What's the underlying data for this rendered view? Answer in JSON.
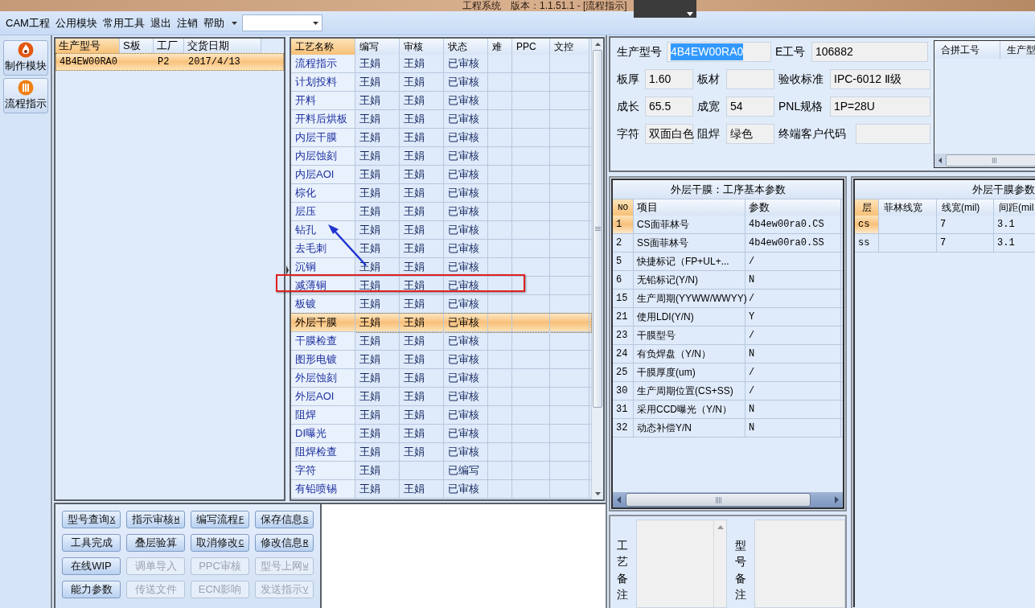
{
  "window": {
    "title": "工程系统　版本：1.1.51.1 - [流程指示]"
  },
  "menu": [
    "CAM工程",
    "公用模块",
    "常用工具",
    "退出",
    "注销",
    "帮助"
  ],
  "nav": [
    {
      "label": "制作模块",
      "kind": "flame"
    },
    {
      "label": "流程指示",
      "kind": "pause"
    }
  ],
  "orders": {
    "columns": [
      "生产型号",
      "S板",
      "工厂",
      "交货日期"
    ],
    "rows": [
      {
        "cells": [
          "4B4EW00RA0",
          "",
          "P2",
          "2017/4/13"
        ],
        "selected": true
      }
    ]
  },
  "process": {
    "columns": [
      "工艺名称",
      "编写",
      "审核",
      "状态",
      "难",
      "PPC",
      "文控"
    ],
    "rows": [
      {
        "name": "流程指示",
        "writer": "王娟",
        "reviewer": "王娟",
        "status": "已审核",
        "selected": false,
        "highlighted": false
      },
      {
        "name": "计划投料",
        "writer": "王娟",
        "reviewer": "王娟",
        "status": "已审核",
        "selected": false,
        "highlighted": false
      },
      {
        "name": "开料",
        "writer": "王娟",
        "reviewer": "王娟",
        "status": "已审核",
        "selected": false,
        "highlighted": false
      },
      {
        "name": "开料后烘板",
        "writer": "王娟",
        "reviewer": "王娟",
        "status": "已审核",
        "selected": false,
        "highlighted": false
      },
      {
        "name": "内层干膜",
        "writer": "王娟",
        "reviewer": "王娟",
        "status": "已审核",
        "selected": false,
        "highlighted": false
      },
      {
        "name": "内层蚀刻",
        "writer": "王娟",
        "reviewer": "王娟",
        "status": "已审核",
        "selected": false,
        "highlighted": false
      },
      {
        "name": "内层AOI",
        "writer": "王娟",
        "reviewer": "王娟",
        "status": "已审核",
        "selected": false,
        "highlighted": false
      },
      {
        "name": "棕化",
        "writer": "王娟",
        "reviewer": "王娟",
        "status": "已审核",
        "selected": false,
        "highlighted": false
      },
      {
        "name": "层压",
        "writer": "王娟",
        "reviewer": "王娟",
        "status": "已审核",
        "selected": false,
        "highlighted": false
      },
      {
        "name": "钻孔",
        "writer": "王娟",
        "reviewer": "王娟",
        "status": "已审核",
        "selected": false,
        "highlighted": false
      },
      {
        "name": "去毛刺",
        "writer": "王娟",
        "reviewer": "王娟",
        "status": "已审核",
        "selected": false,
        "highlighted": false
      },
      {
        "name": "沉铜",
        "writer": "王娟",
        "reviewer": "王娟",
        "status": "已审核",
        "selected": false,
        "highlighted": false
      },
      {
        "name": "减薄铜",
        "writer": "王娟",
        "reviewer": "王娟",
        "status": "已审核",
        "selected": false,
        "highlighted": true
      },
      {
        "name": "板镀",
        "writer": "王娟",
        "reviewer": "王娟",
        "status": "已审核",
        "selected": false,
        "highlighted": false
      },
      {
        "name": "外层干膜",
        "writer": "王娟",
        "reviewer": "王娟",
        "status": "已审核",
        "selected": true,
        "highlighted": false
      },
      {
        "name": "干膜检查",
        "writer": "王娟",
        "reviewer": "王娟",
        "status": "已审核",
        "selected": false,
        "highlighted": false
      },
      {
        "name": "图形电镀",
        "writer": "王娟",
        "reviewer": "王娟",
        "status": "已审核",
        "selected": false,
        "highlighted": false
      },
      {
        "name": "外层蚀刻",
        "writer": "王娟",
        "reviewer": "王娟",
        "status": "已审核",
        "selected": false,
        "highlighted": false
      },
      {
        "name": "外层AOI",
        "writer": "王娟",
        "reviewer": "王娟",
        "status": "已审核",
        "selected": false,
        "highlighted": false
      },
      {
        "name": "阻焊",
        "writer": "王娟",
        "reviewer": "王娟",
        "status": "已审核",
        "selected": false,
        "highlighted": false
      },
      {
        "name": "DI曝光",
        "writer": "王娟",
        "reviewer": "王娟",
        "status": "已审核",
        "selected": false,
        "highlighted": false
      },
      {
        "name": "阻焊检查",
        "writer": "王娟",
        "reviewer": "王娟",
        "status": "已审核",
        "selected": false,
        "highlighted": false
      },
      {
        "name": "字符",
        "writer": "王娟",
        "status": "已编写",
        "selected": false,
        "highlighted": false
      },
      {
        "name": "有铅喷锡",
        "writer": "王娟",
        "reviewer": "王娟",
        "status": "已审核",
        "selected": false,
        "highlighted": false
      }
    ]
  },
  "actions": [
    {
      "label": "型号查询",
      "hotkey": "X",
      "disabled": false
    },
    {
      "label": "指示审核",
      "hotkey": "H",
      "disabled": false
    },
    {
      "label": "编写流程",
      "hotkey": "F",
      "disabled": false
    },
    {
      "label": "保存信息",
      "hotkey": "S",
      "disabled": false
    },
    {
      "label": "工具完成",
      "disabled": false
    },
    {
      "label": "叠层验算",
      "disabled": false
    },
    {
      "label": "取消修改",
      "hotkey": "C",
      "disabled": false
    },
    {
      "label": "修改信息",
      "hotkey": "R",
      "disabled": false
    },
    {
      "label": "在线WIP",
      "disabled": false
    },
    {
      "label": "调单导入",
      "disabled": true
    },
    {
      "label": "PPC审核",
      "disabled": true
    },
    {
      "label": "型号上网",
      "hotkey": "W",
      "disabled": true
    },
    {
      "label": "能力参数",
      "disabled": false
    },
    {
      "label": "传送文件",
      "disabled": true
    },
    {
      "label": "ECN影响",
      "disabled": true
    },
    {
      "label": "发送指示",
      "hotkey": "V",
      "disabled": true
    }
  ],
  "info": {
    "fields": [
      {
        "label": "生产型号",
        "value": "4B4EW00RA0",
        "text_selected": true
      },
      {
        "label": "E工号",
        "value": "106882"
      },
      {
        "label": "板厚",
        "value": "1.60"
      },
      {
        "label": "板材"
      },
      {
        "label": "验收标准",
        "value": "IPC-6012 Ⅱ级"
      },
      {
        "label": "成长",
        "value": "65.5"
      },
      {
        "label": "成宽",
        "value": "54"
      },
      {
        "label": "PNL规格",
        "value": "1P=28U"
      },
      {
        "label": "字符",
        "value": "双面白色"
      },
      {
        "label": "阻焊",
        "value": "绿色"
      },
      {
        "label": "终端客户代码"
      }
    ]
  },
  "merge_table": {
    "columns": [
      "合拼工号",
      "生产型"
    ]
  },
  "params": {
    "title": "外层干膜：工序基本参数",
    "columns": [
      "NO",
      "项目",
      "参数"
    ],
    "rows": [
      {
        "no": "1",
        "item": "CS面菲林号",
        "value": "4b4ew00ra0.CS",
        "selected": true
      },
      {
        "no": "2",
        "item": "SS面菲林号",
        "value": "4b4ew00ra0.SS",
        "selected": false
      },
      {
        "no": "5",
        "item": "快捷标记（FP+UL+...",
        "value": "/",
        "selected": false
      },
      {
        "no": "6",
        "item": "无铅标记(Y/N)",
        "value": "N",
        "selected": false
      },
      {
        "no": "15",
        "item": "生产周期(YYWW/WWYY)",
        "value": "/",
        "selected": false
      },
      {
        "no": "21",
        "item": "使用LDI(Y/N)",
        "value": "Y",
        "selected": false
      },
      {
        "no": "23",
        "item": "干膜型号",
        "value": "/",
        "selected": false
      },
      {
        "no": "24",
        "item": "有负焊盘（Y/N）",
        "value": "N",
        "selected": false
      },
      {
        "no": "25",
        "item": "干膜厚度(um)",
        "value": "/",
        "selected": false
      },
      {
        "no": "30",
        "item": "生产周期位置(CS+SS)",
        "value": "/",
        "selected": false
      },
      {
        "no": "31",
        "item": "采用CCD曝光（Y/N）",
        "value": "N",
        "selected": false
      },
      {
        "no": "32",
        "item": "动态补偿Y/N",
        "value": "N",
        "selected": false
      }
    ]
  },
  "layers": {
    "title": "外层干膜参数",
    "columns": [
      "层",
      "菲林线宽",
      "线宽(mil)",
      "间距(mil"
    ],
    "rows": [
      {
        "cells": [
          "cs",
          "",
          "7",
          "3.1"
        ],
        "selected": true
      },
      {
        "cells": [
          "ss",
          "",
          "7",
          "3.1"
        ],
        "selected": false
      }
    ]
  },
  "notes": [
    {
      "label": "工艺备注"
    },
    {
      "label": "型号备注"
    }
  ]
}
